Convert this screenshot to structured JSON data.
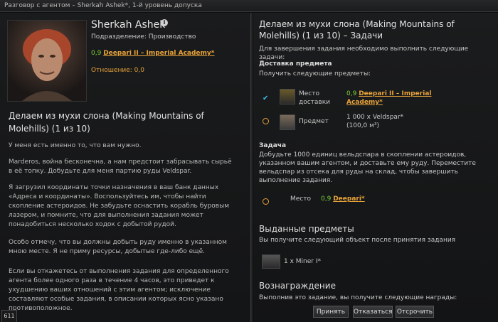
{
  "window": {
    "title": "Разговор с агентом – Sherkah Ashek*, 1-й уровень допуска"
  },
  "agent": {
    "name": "Sherkah Ashek",
    "division": "Подразделение: Производство",
    "location_security": "0,9",
    "location_name": "Deepari II – Imperial Academy*",
    "relation": "Отношение: 0,0"
  },
  "left_panel": {
    "mission_title": "Делаем из мухи слона (Making Mountains of Molehills) (1 из 10)",
    "paragraphs": [
      "У меня есть именно то, что вам нужно.",
      "Marderos, война бесконечна, а нам предстоит забрасывать сырьё в её топку. Добудьте для меня партию руды Veldspar.",
      "Я загрузил координаты точки назначения в ваш банк данных «Адреса и координаты». Воспользуйтесь им, чтобы найти скопление астероидов. Не забудьте оснастить корабль буровым лазером, и помните, что для выполнения задания может понадобиться несколько ходок с добытой рудой.",
      "Особо отмечу, что вы должны добыть руду именно в указанном мною месте. Я не приму ресурсы, добытые где-либо ещё.",
      "Если вы откажетесь от выполнения задания для определенного агента более одного раза в течение 4 часов, это приведет к ухудшению ваших отношений с этим агентом; исключение составляют особые задания, в описании которых ясно указано противоположное."
    ],
    "badge": "611"
  },
  "right_panel": {
    "title": "Делаем из мухи слона (Making Mountains of Molehills) (1 из 10) – Задачи",
    "intro": "Для завершения задания необходимо выполнить следующие задачи:",
    "delivery_header": "Доставка предмета",
    "delivery_sub": "Получить следующие предметы:",
    "row1_label": "Место доставки",
    "row1_sec": "0,9",
    "row1_value": "Deepari II – Imperial Academy*",
    "row2_label": "Предмет",
    "row2_value": "1 000 x Veldspar*",
    "row2_volume": "(100,0 м³)",
    "task_header": "Задача",
    "task_text": "Добудьте 1000 единиц вельдспара в скоплении астероидов, указанном вашим агентом, и доставьте ему руду. Переместите вельдспар из отсека для руды на склад, чтобы завершить выполнение задания.",
    "task_place_label": "Место",
    "task_place_sec": "0,9",
    "task_place_value": "Deepari*",
    "issued_header": "Выданные предметы",
    "issued_sub": "Вы получите следующий объект после принятия задания",
    "issued_item": "1 x Miner I*",
    "reward_header": "Вознаграждение",
    "reward_sub": "Выполнив это задание, вы получите следующие награды:"
  },
  "buttons": {
    "accept": "Принять",
    "decline": "Отказаться",
    "defer": "Отсрочить"
  },
  "colors": {
    "accent_orange": "#e8a33a",
    "security_green": "#7fd13b",
    "check_blue": "#3fb7e6"
  }
}
